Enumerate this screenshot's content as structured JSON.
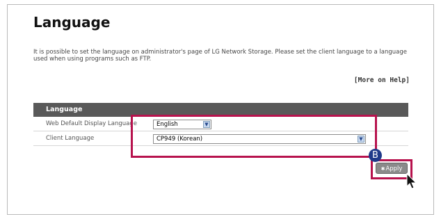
{
  "page": {
    "title": "Language",
    "description": "It is possible to set the language on administrator's page of LG Network Storage. Please set the client language to a language used when using programs such as FTP.",
    "help_link": "[More on Help]"
  },
  "table": {
    "header": "Language",
    "rows": [
      {
        "label": "Web Default Display Language",
        "value": "English"
      },
      {
        "label": "Client Language",
        "value": "CP949 (Korean)"
      }
    ]
  },
  "actions": {
    "apply_label": "Apply"
  },
  "annotation": {
    "marker_label": "B",
    "highlight_color": "#b7124d"
  }
}
